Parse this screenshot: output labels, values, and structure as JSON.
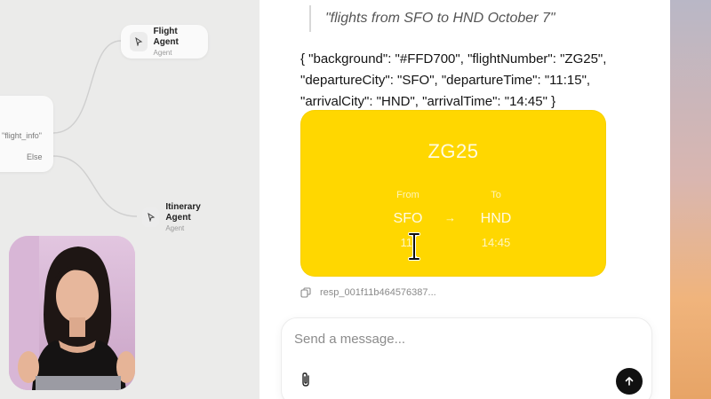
{
  "workflow": {
    "branch_condition": "\"flight_info\"",
    "branch_else": "Else",
    "flight_agent": {
      "title": "Flight Agent",
      "subtitle": "Agent"
    },
    "itinerary_agent": {
      "title": "Itinerary Agent",
      "subtitle": "Agent"
    }
  },
  "chat": {
    "user_quote": "\"flights from SFO to HND October 7\"",
    "json_lines": [
      "{ \"background\": \"#FFD700\", \"flightNumber\": \"ZG25\",",
      "\"departureCity\": \"SFO\", \"departureTime\": \"11:15\",",
      "\"arrivalCity\": \"HND\", \"arrivalTime\": \"14:45\" }"
    ],
    "card": {
      "background": "#FFD700",
      "flight_number": "ZG25",
      "from_label": "From",
      "to_label": "To",
      "departure_city": "SFO",
      "arrival_city": "HND",
      "departure_time": "11:",
      "arrival_time": "14:45",
      "arrow": "→"
    },
    "response_id": "resp_001f11b464576387...",
    "composer": {
      "placeholder": "Send a message..."
    }
  },
  "icons": {
    "agent_node": "cursor-arrow-icon",
    "copy": "copy-icon",
    "attach": "paperclip-icon",
    "send": "arrow-up-icon",
    "text_cursor": "i-beam-cursor-icon"
  },
  "colors": {
    "accent": "#FFD700",
    "send_button": "#111111"
  }
}
